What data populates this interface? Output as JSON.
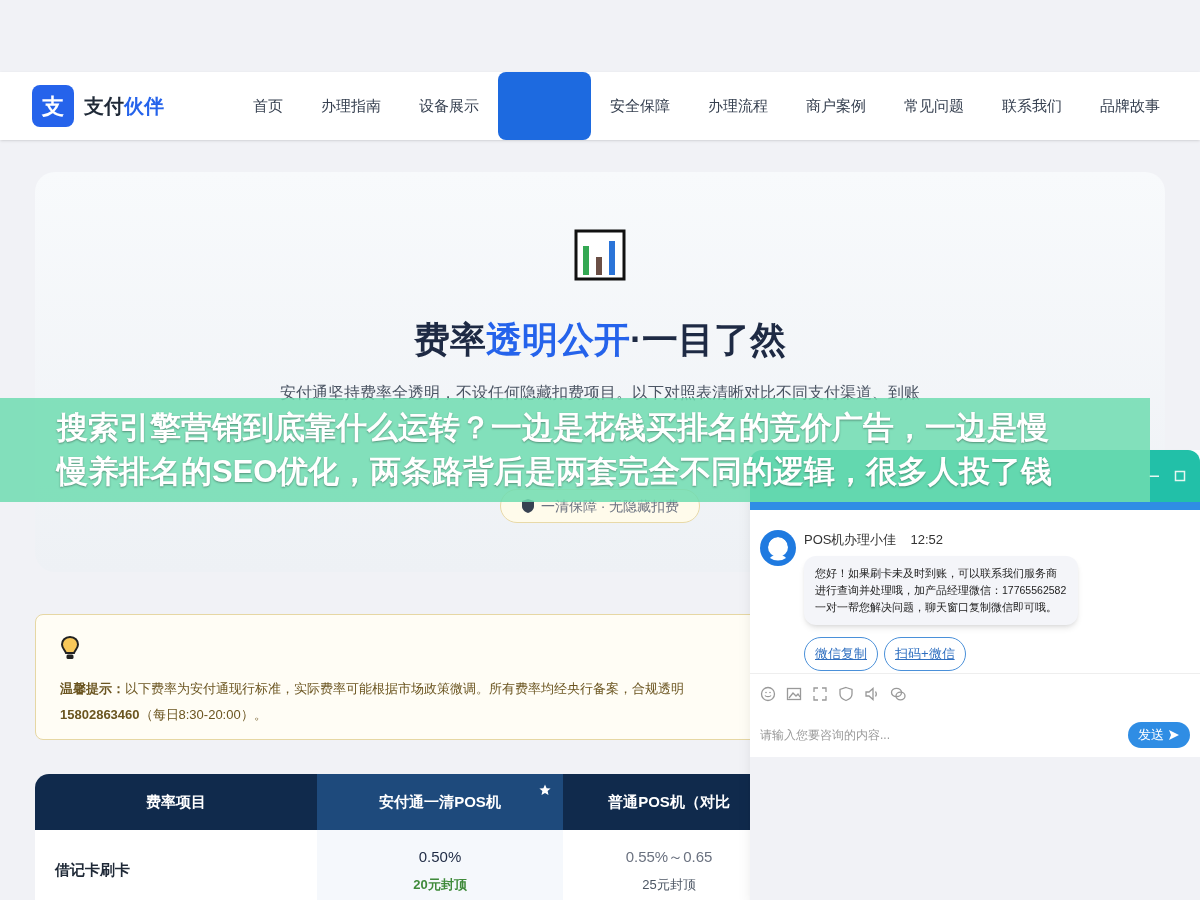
{
  "brand": {
    "icon": "支",
    "name_main": "支付",
    "name_accent": "伙伴"
  },
  "nav": [
    {
      "label": "首页",
      "selected": false
    },
    {
      "label": "办理指南",
      "selected": false
    },
    {
      "label": "设备展示",
      "selected": false
    },
    {
      "selected": true
    },
    {
      "label": "安全保障",
      "selected": false
    },
    {
      "label": "办理流程",
      "selected": false
    },
    {
      "label": "商户案例",
      "selected": false
    },
    {
      "label": "常见问题",
      "selected": false
    },
    {
      "label": "联系我们",
      "selected": false
    },
    {
      "label": "品牌故事",
      "selected": false
    }
  ],
  "hero": {
    "title_main": "费率",
    "title_accent": "透明公开",
    "title_rest": "·一目了然",
    "description": "安付通坚持费率全透明，不设任何隐藏扣费项目。以下对照表清晰对比不同支付渠道、到账",
    "badge": "一清保障 · 无隐藏扣费"
  },
  "tip": {
    "line_1": "**温馨提示：**以下费率为安付通现行标准，实际费率可能根据市场政策微调。所有费率均经央行备案，合规透明",
    "line_2": "**15802863460**（每日8:30-20:00）。"
  },
  "table": {
    "columns": [
      {
        "label": "费率项目",
        "highlighted": false
      },
      {
        "label": "安付通一清POS机",
        "highlighted": true
      },
      {
        "label": "普通POS机（对比",
        "highlighted": false
      }
    ],
    "rows": [
      {
        "cells": [
          {
            "value": "借记卡刷卡"
          },
          {
            "value": "0.50%",
            "note": "20元封顶"
          },
          {
            "value": "0.55%～0.65",
            "note": "25元封顶"
          }
        ]
      }
    ]
  },
  "banner": {
    "lines": [
      "搜索引擎营销到底靠什么运转？一边是花钱买排名的竞价广告，一边是慢",
      "慢养排名的SEO优化，两条路背后是两套完全不同的逻辑，很多人投了钱"
    ]
  },
  "chat": {
    "agent": "POS机办理小佳",
    "time": "12:52",
    "message": "您好！如果刷卡未及时到账，可以联系我们服务商进行查询并处理哦，加产品经理微信：17765562582 一对一帮您解决问题，聊天窗口复制微信即可哦。",
    "actions": [
      "微信复制",
      "扫码+微信"
    ],
    "placeholder": "请输入您要咨询的内容...",
    "send": "发送"
  }
}
